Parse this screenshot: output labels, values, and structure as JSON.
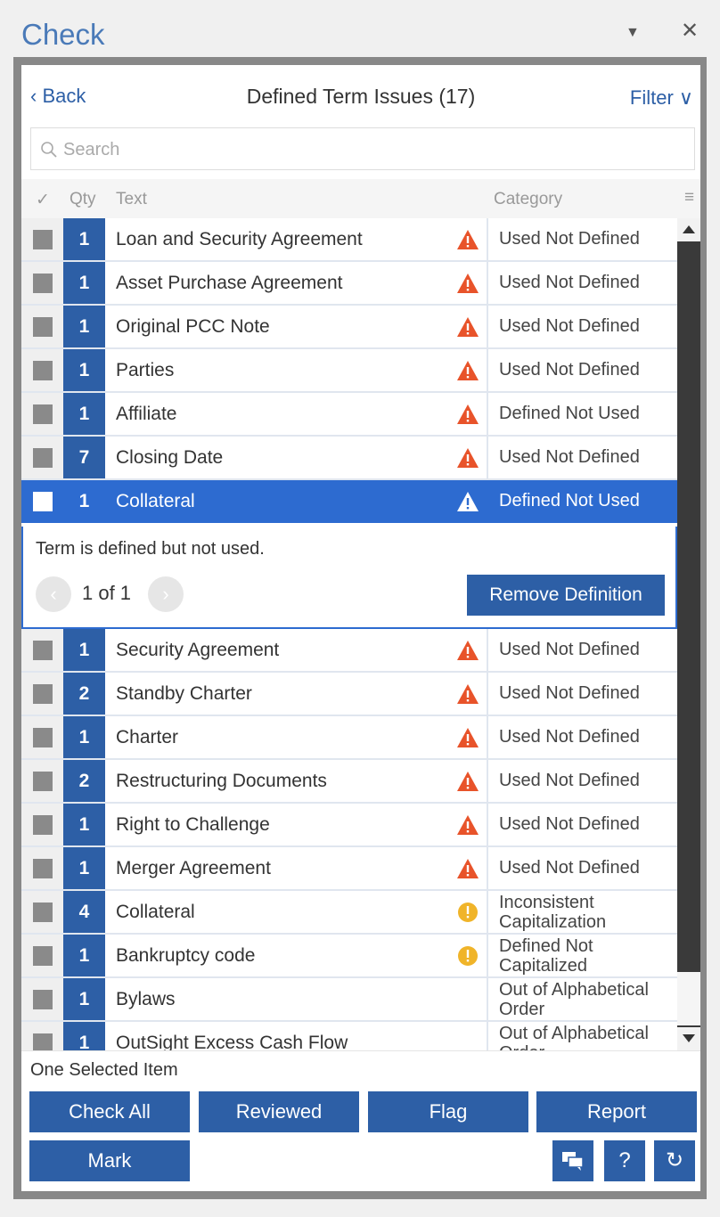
{
  "pane": {
    "title": "Check",
    "dropdown_glyph": "▼",
    "close_glyph": "✕"
  },
  "header": {
    "back_label": "‹ Back",
    "title": "Defined Term Issues (17)",
    "filter_label": "Filter ∨"
  },
  "search": {
    "placeholder": "Search",
    "value": ""
  },
  "columns": {
    "check": "✓",
    "qty": "Qty",
    "text": "Text",
    "category": "Category",
    "menu": "≡"
  },
  "rows_top": [
    {
      "qty": "1",
      "text": "Loan and Security Agreement",
      "icon": "warning-icon",
      "category": "Used Not Defined"
    },
    {
      "qty": "1",
      "text": "Asset Purchase Agreement",
      "icon": "warning-icon",
      "category": "Used Not Defined"
    },
    {
      "qty": "1",
      "text": "Original PCC Note",
      "icon": "warning-icon",
      "category": "Used Not Defined"
    },
    {
      "qty": "1",
      "text": "Parties",
      "icon": "warning-icon",
      "category": "Used Not Defined"
    },
    {
      "qty": "1",
      "text": "Affiliate",
      "icon": "warning-icon",
      "category": "Defined Not Used"
    },
    {
      "qty": "7",
      "text": "Closing Date",
      "icon": "warning-icon",
      "category": "Used Not Defined"
    }
  ],
  "selected_row": {
    "qty": "1",
    "text": "Collateral",
    "icon": "warning-icon",
    "category": "Defined Not Used"
  },
  "detail": {
    "message": "Term is defined but not used.",
    "pager": "1 of 1",
    "prev_glyph": "‹",
    "next_glyph": "›",
    "action_label": "Remove Definition"
  },
  "rows_bottom": [
    {
      "qty": "1",
      "text": "Security Agreement",
      "icon": "warning-icon",
      "category": "Used Not Defined"
    },
    {
      "qty": "2",
      "text": "Standby Charter",
      "icon": "warning-icon",
      "category": "Used Not Defined"
    },
    {
      "qty": "1",
      "text": "Charter",
      "icon": "warning-icon",
      "category": "Used Not Defined"
    },
    {
      "qty": "2",
      "text": "Restructuring Documents",
      "icon": "warning-icon",
      "category": "Used Not Defined"
    },
    {
      "qty": "1",
      "text": "Right to Challenge",
      "icon": "warning-icon",
      "category": "Used Not Defined"
    },
    {
      "qty": "1",
      "text": "Merger Agreement",
      "icon": "warning-icon",
      "category": "Used Not Defined"
    },
    {
      "qty": "4",
      "text": "Collateral",
      "icon": "info-icon",
      "category": "Inconsistent Capitalization"
    },
    {
      "qty": "1",
      "text": "Bankruptcy code",
      "icon": "info-icon",
      "category": "Defined Not Capitalized"
    },
    {
      "qty": "1",
      "text": "Bylaws",
      "icon": "",
      "category": "Out of Alphabetical Order"
    },
    {
      "qty": "1",
      "text": "OutSight Excess Cash Flow",
      "icon": "",
      "category": "Out of Alphabetical Order"
    }
  ],
  "footer": {
    "selection_info": "One Selected Item",
    "buttons": {
      "check_all": "Check All",
      "reviewed": "Reviewed",
      "flag": "Flag",
      "report": "Report",
      "mark": "Mark"
    },
    "help_glyph": "?",
    "refresh_glyph": "↻"
  },
  "colors": {
    "accent": "#2d5fa6",
    "selected": "#2d6bd0",
    "warning": "#e8532a",
    "info": "#f0b429",
    "title": "#4a7ab8"
  }
}
